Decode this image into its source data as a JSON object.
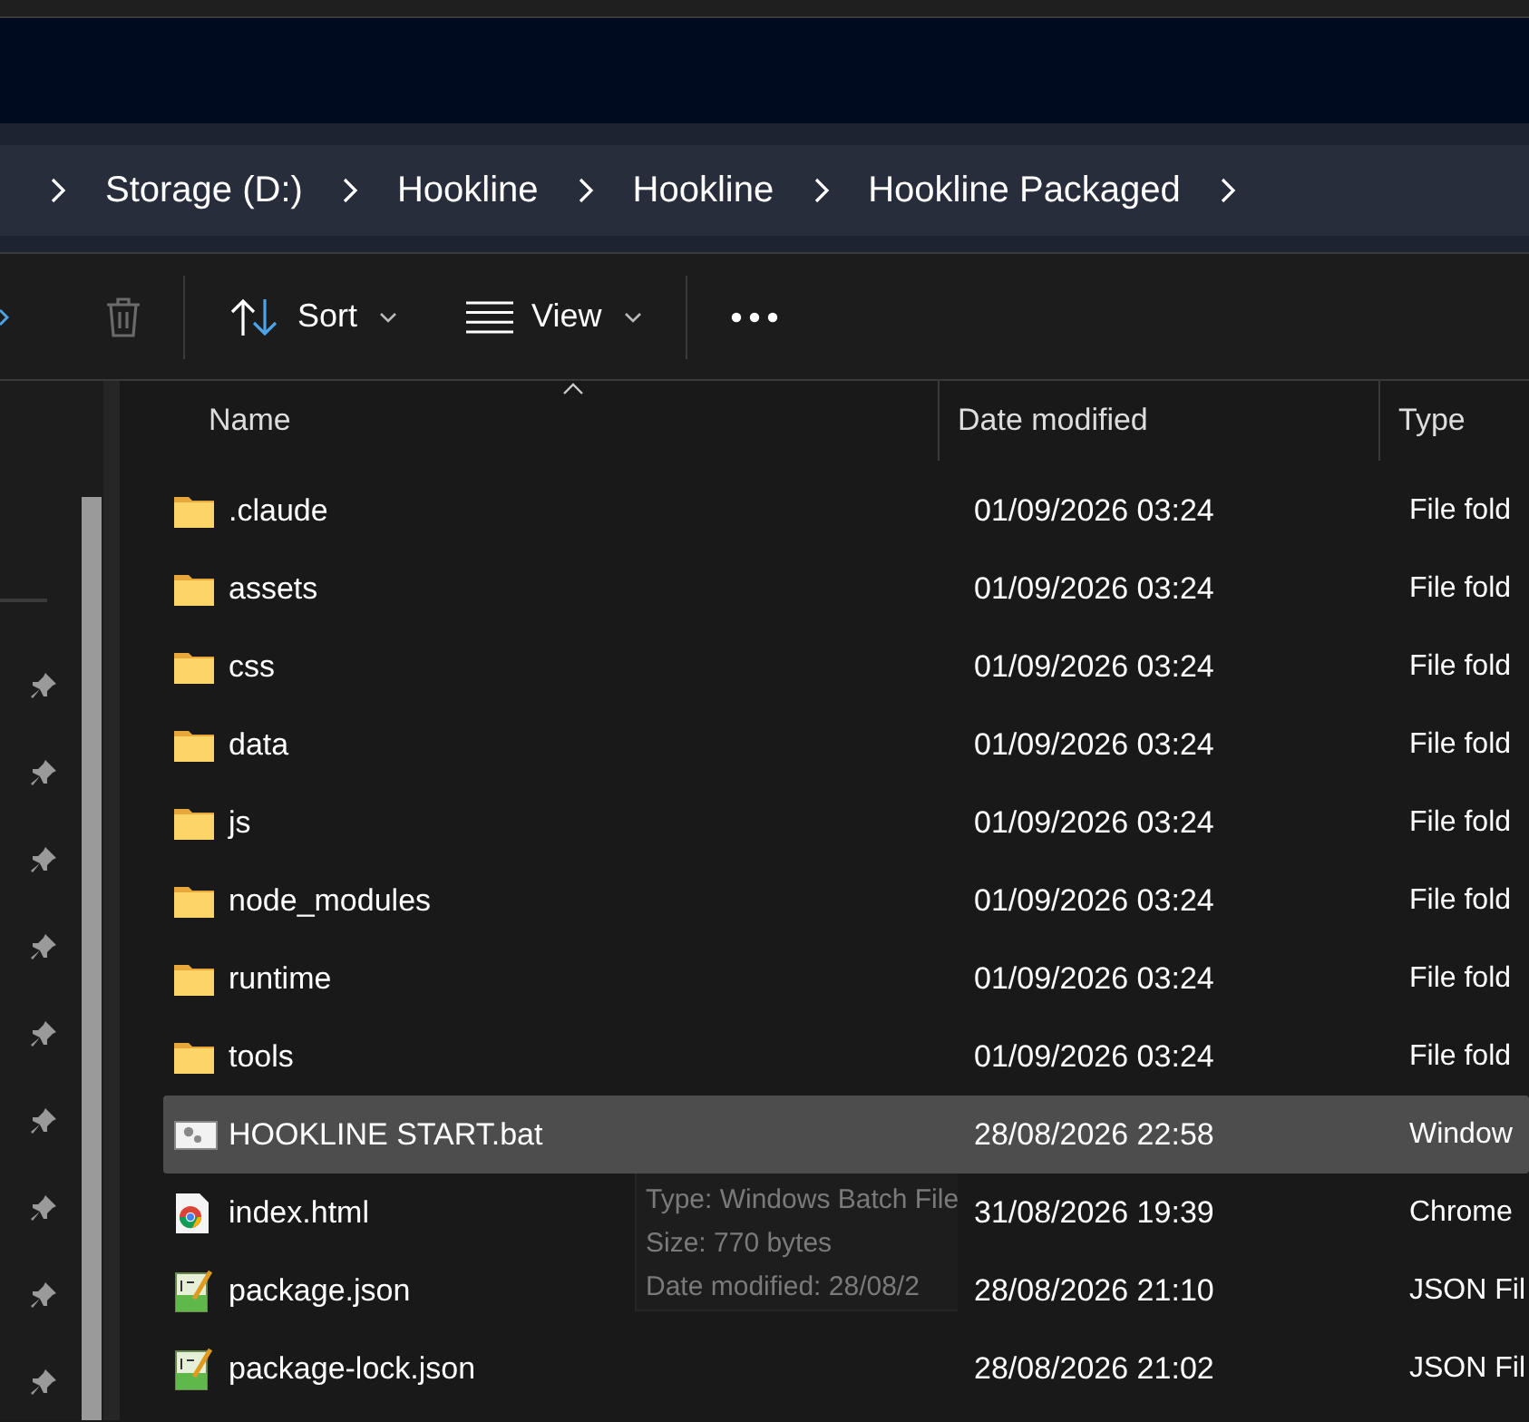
{
  "breadcrumbs": [
    "Storage (D:)",
    "Hookline",
    "Hookline",
    "Hookline Packaged"
  ],
  "toolbar": {
    "sort": "Sort",
    "view": "View"
  },
  "columns": [
    {
      "label": "Name",
      "sorted": true
    },
    {
      "label": "Date modified",
      "sorted": false
    },
    {
      "label": "Type",
      "sorted": false
    }
  ],
  "rows": [
    {
      "name": ".claude",
      "date": "01/09/2026 03:24",
      "type": "File fold",
      "kind": "folder",
      "selected": false
    },
    {
      "name": "assets",
      "date": "01/09/2026 03:24",
      "type": "File fold",
      "kind": "folder",
      "selected": false
    },
    {
      "name": "css",
      "date": "01/09/2026 03:24",
      "type": "File fold",
      "kind": "folder",
      "selected": false
    },
    {
      "name": "data",
      "date": "01/09/2026 03:24",
      "type": "File fold",
      "kind": "folder",
      "selected": false
    },
    {
      "name": "js",
      "date": "01/09/2026 03:24",
      "type": "File fold",
      "kind": "folder",
      "selected": false
    },
    {
      "name": "node_modules",
      "date": "01/09/2026 03:24",
      "type": "File fold",
      "kind": "folder",
      "selected": false
    },
    {
      "name": "runtime",
      "date": "01/09/2026 03:24",
      "type": "File fold",
      "kind": "folder",
      "selected": false
    },
    {
      "name": "tools",
      "date": "01/09/2026 03:24",
      "type": "File fold",
      "kind": "folder",
      "selected": false
    },
    {
      "name": "HOOKLINE START.bat",
      "date": "28/08/2026 22:58",
      "type": "Window",
      "kind": "batch",
      "selected": true
    },
    {
      "name": "index.html",
      "date": "31/08/2026 19:39",
      "type": "Chrome",
      "kind": "html",
      "selected": false
    },
    {
      "name": "package.json",
      "date": "28/08/2026 21:10",
      "type": "JSON Fil",
      "kind": "json",
      "selected": false
    },
    {
      "name": "package-lock.json",
      "date": "28/08/2026 21:02",
      "type": "JSON Fil",
      "kind": "json",
      "selected": false
    }
  ],
  "tooltip": [
    "Type: Windows Batch File",
    "Size: 770 bytes",
    "Date modified: 28/08/2"
  ]
}
